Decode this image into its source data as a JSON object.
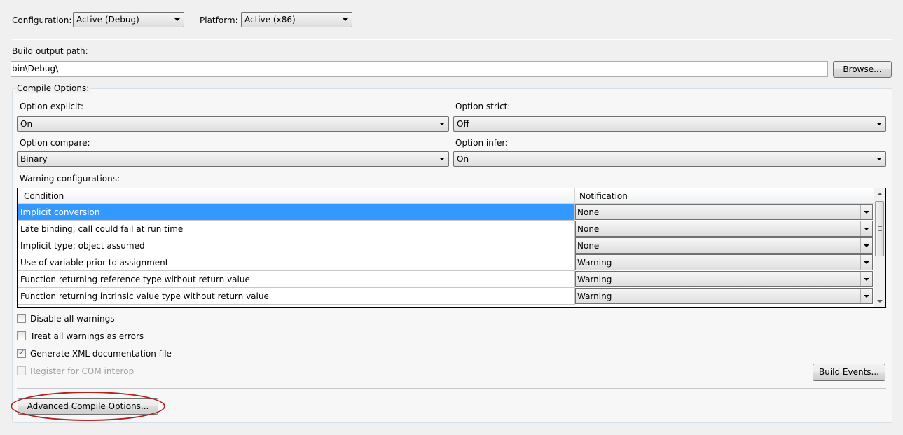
{
  "top": {
    "configuration_label": "Configuration:",
    "configuration_value": "Active (Debug)",
    "platform_label": "Platform:",
    "platform_value": "Active (x86)"
  },
  "output": {
    "label": "Build output path:",
    "value": "bin\\Debug\\",
    "browse_label": "Browse..."
  },
  "compile": {
    "group_label": "Compile Options:",
    "option_explicit_label": "Option explicit:",
    "option_explicit_value": "On",
    "option_strict_label": "Option strict:",
    "option_strict_value": "Off",
    "option_compare_label": "Option compare:",
    "option_compare_value": "Binary",
    "option_infer_label": "Option infer:",
    "option_infer_value": "On",
    "warnings_label": "Warning configurations:"
  },
  "grid": {
    "headers": {
      "condition": "Condition",
      "notification": "Notification"
    },
    "rows": [
      {
        "condition": "Implicit conversion",
        "notification": "None",
        "selected": true
      },
      {
        "condition": "Late binding; call could fail at run time",
        "notification": "None"
      },
      {
        "condition": "Implicit type; object assumed",
        "notification": "None"
      },
      {
        "condition": "Use of variable prior to assignment",
        "notification": "Warning"
      },
      {
        "condition": "Function returning reference type without return value",
        "notification": "Warning"
      },
      {
        "condition": "Function returning intrinsic value type without return value",
        "notification": "Warning"
      }
    ]
  },
  "checks": {
    "disable_all": {
      "label": "Disable all warnings",
      "checked": false
    },
    "treat_errors": {
      "label": "Treat all warnings as errors",
      "checked": false
    },
    "xml_doc": {
      "label": "Generate XML documentation file",
      "checked": true
    },
    "com_interop": {
      "label": "Register for COM interop",
      "checked": false,
      "disabled": true
    }
  },
  "buttons": {
    "build_events": "Build Events...",
    "advanced": "Advanced Compile Options..."
  },
  "icons": {
    "check": "✓"
  },
  "colors": {
    "selection": "#3399ff",
    "highlight_ring": "#b22222"
  }
}
